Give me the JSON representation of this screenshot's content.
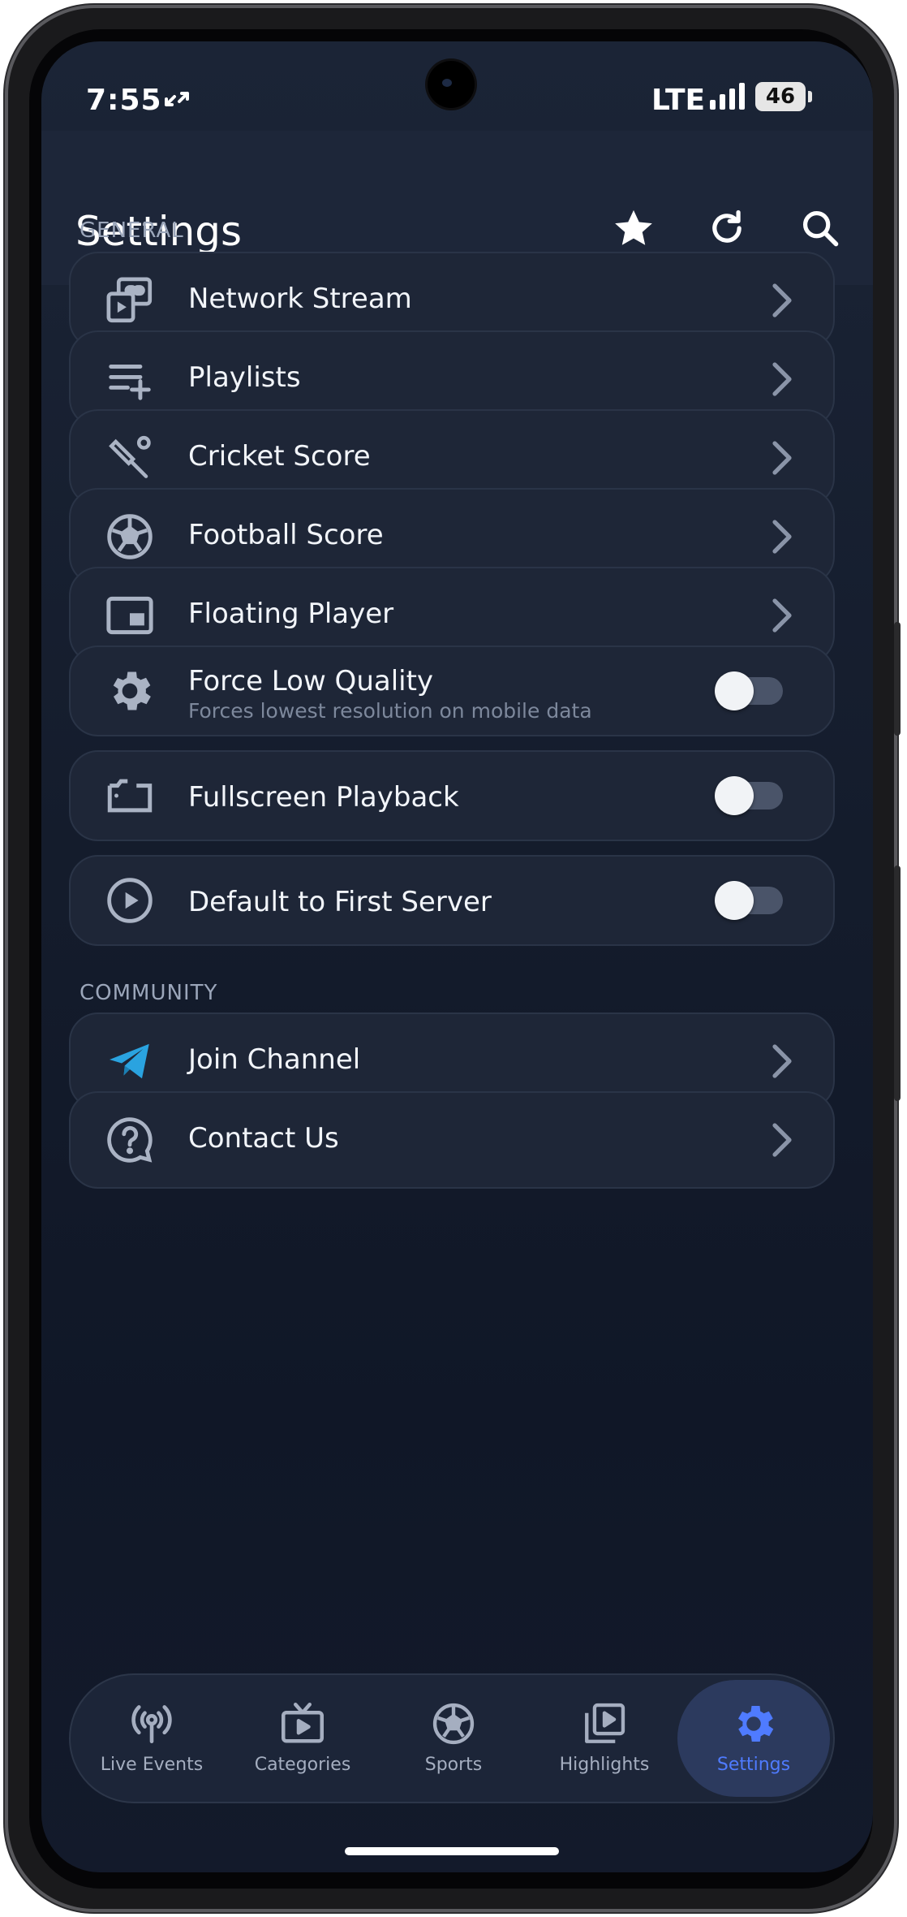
{
  "status_bar": {
    "time": "7:55",
    "network": "LTE",
    "battery": "46"
  },
  "app_bar": {
    "title": "Settings",
    "icons": [
      "star-icon",
      "refresh-icon",
      "search-icon"
    ]
  },
  "sections": {
    "general": "GENERAL",
    "community": "COMMUNITY"
  },
  "general_items": [
    {
      "label": "Network Stream",
      "icon": "network-stream-icon",
      "control": "chevron"
    },
    {
      "label": "Playlists",
      "icon": "playlist-add-icon",
      "control": "chevron"
    },
    {
      "label": "Cricket Score",
      "icon": "cricket-icon",
      "control": "chevron"
    },
    {
      "label": "Football Score",
      "icon": "football-icon",
      "control": "chevron"
    },
    {
      "label": "Floating Player",
      "icon": "picture-in-picture-icon",
      "control": "chevron"
    },
    {
      "label": "Force Low Quality",
      "sublabel": "Forces lowest resolution on mobile data",
      "icon": "gear-icon",
      "control": "toggle",
      "enabled": false
    },
    {
      "label": "Fullscreen Playback",
      "icon": "fullscreen-icon",
      "control": "toggle",
      "enabled": false
    },
    {
      "label": "Default to First Server",
      "icon": "play-circle-icon",
      "control": "toggle",
      "enabled": false
    }
  ],
  "community_items": [
    {
      "label": "Join Channel",
      "icon": "telegram-icon",
      "control": "chevron"
    },
    {
      "label": "Contact Us",
      "icon": "help-circle-icon",
      "control": "chevron"
    }
  ],
  "bottom_nav": [
    {
      "label": "Live Events",
      "icon": "broadcast-icon",
      "active": false
    },
    {
      "label": "Categories",
      "icon": "tv-icon",
      "active": false
    },
    {
      "label": "Sports",
      "icon": "football-icon",
      "active": false
    },
    {
      "label": "Highlights",
      "icon": "video-library-icon",
      "active": false
    },
    {
      "label": "Settings",
      "icon": "gear-icon",
      "active": true
    }
  ],
  "colors": {
    "accent": "#4f7bff",
    "telegram": "#2aa3e0",
    "card": "#1e2637",
    "background": "#141c2c"
  }
}
